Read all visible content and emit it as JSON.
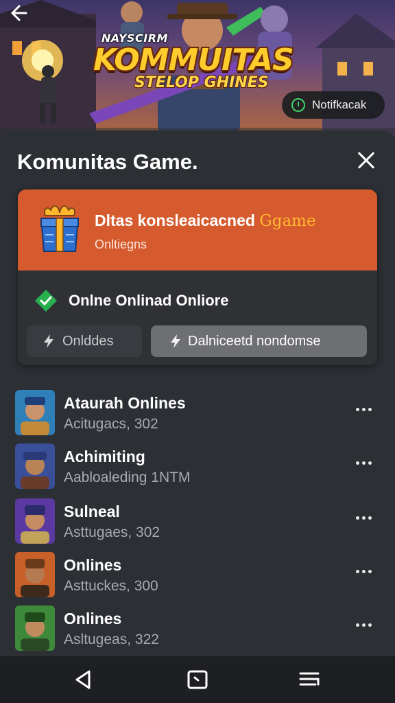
{
  "banner": {
    "logo_sub": "NAYSCIRM",
    "logo_main": "KOMMUITAS",
    "logo_tag": "STELOP GHINES",
    "notification_label": "Notifkacak"
  },
  "sheet": {
    "title": "Komunitas Game."
  },
  "card": {
    "title": "Dltas konsleaicacned",
    "title_accent": "Ggame",
    "subtitle": "Onltiegns",
    "status_text": "Onlne Onlinad Onliore",
    "online_button": "Onlddes",
    "download_button": "Dalniceetd nondomse",
    "header_color": "#d55a2e"
  },
  "list": {
    "items": [
      {
        "name": "Ataurah Onlines",
        "meta": "Acitugacs, 302",
        "avatar_colors": [
          "#2f7fb8",
          "#c48a3a"
        ]
      },
      {
        "name": "Achimiting",
        "meta": "Aabloaleding 1NTM",
        "avatar_colors": [
          "#3a4f9a",
          "#6a3b2a"
        ]
      },
      {
        "name": "Sulneal",
        "meta": "Asttugaes, 302",
        "avatar_colors": [
          "#5a3aa0",
          "#c2a35a"
        ]
      },
      {
        "name": "Onlines",
        "meta": "Asttuckes, 300",
        "avatar_colors": [
          "#c8602a",
          "#3e2a1c"
        ]
      },
      {
        "name": "Onlines",
        "meta": "Asltugeas, 322",
        "avatar_colors": [
          "#3f8a3a",
          "#2a4a26"
        ]
      }
    ]
  },
  "colors": {
    "accent_orange": "#d55a2e",
    "status_green": "#3fd46b",
    "sheet_bg": "#2c2f34"
  }
}
